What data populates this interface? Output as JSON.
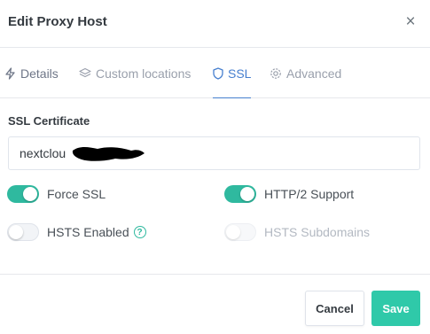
{
  "modal": {
    "title": "Edit Proxy Host",
    "close_symbol": "×"
  },
  "tabs": [
    {
      "label": "Details",
      "icon": "lightning-icon",
      "active": false
    },
    {
      "label": "Custom locations",
      "icon": "layers-icon",
      "active": false
    },
    {
      "label": "SSL",
      "icon": "shield-icon",
      "active": true
    },
    {
      "label": "Advanced",
      "icon": "gear-icon",
      "active": false
    }
  ],
  "ssl": {
    "certificate_label": "SSL Certificate",
    "certificate_value": "nextclou",
    "toggles": {
      "force_ssl": {
        "label": "Force SSL",
        "on": true,
        "disabled": false
      },
      "http2": {
        "label": "HTTP/2 Support",
        "on": true,
        "disabled": false
      },
      "hsts_enabled": {
        "label": "HSTS Enabled",
        "on": false,
        "disabled": false,
        "help": "?"
      },
      "hsts_subdomains": {
        "label": "HSTS Subdomains",
        "on": false,
        "disabled": true
      }
    }
  },
  "footer": {
    "cancel_label": "Cancel",
    "save_label": "Save"
  },
  "colors": {
    "accent": "#2fc9a9",
    "toggle_on": "#2fb99f",
    "tab_active": "#467fcf"
  }
}
